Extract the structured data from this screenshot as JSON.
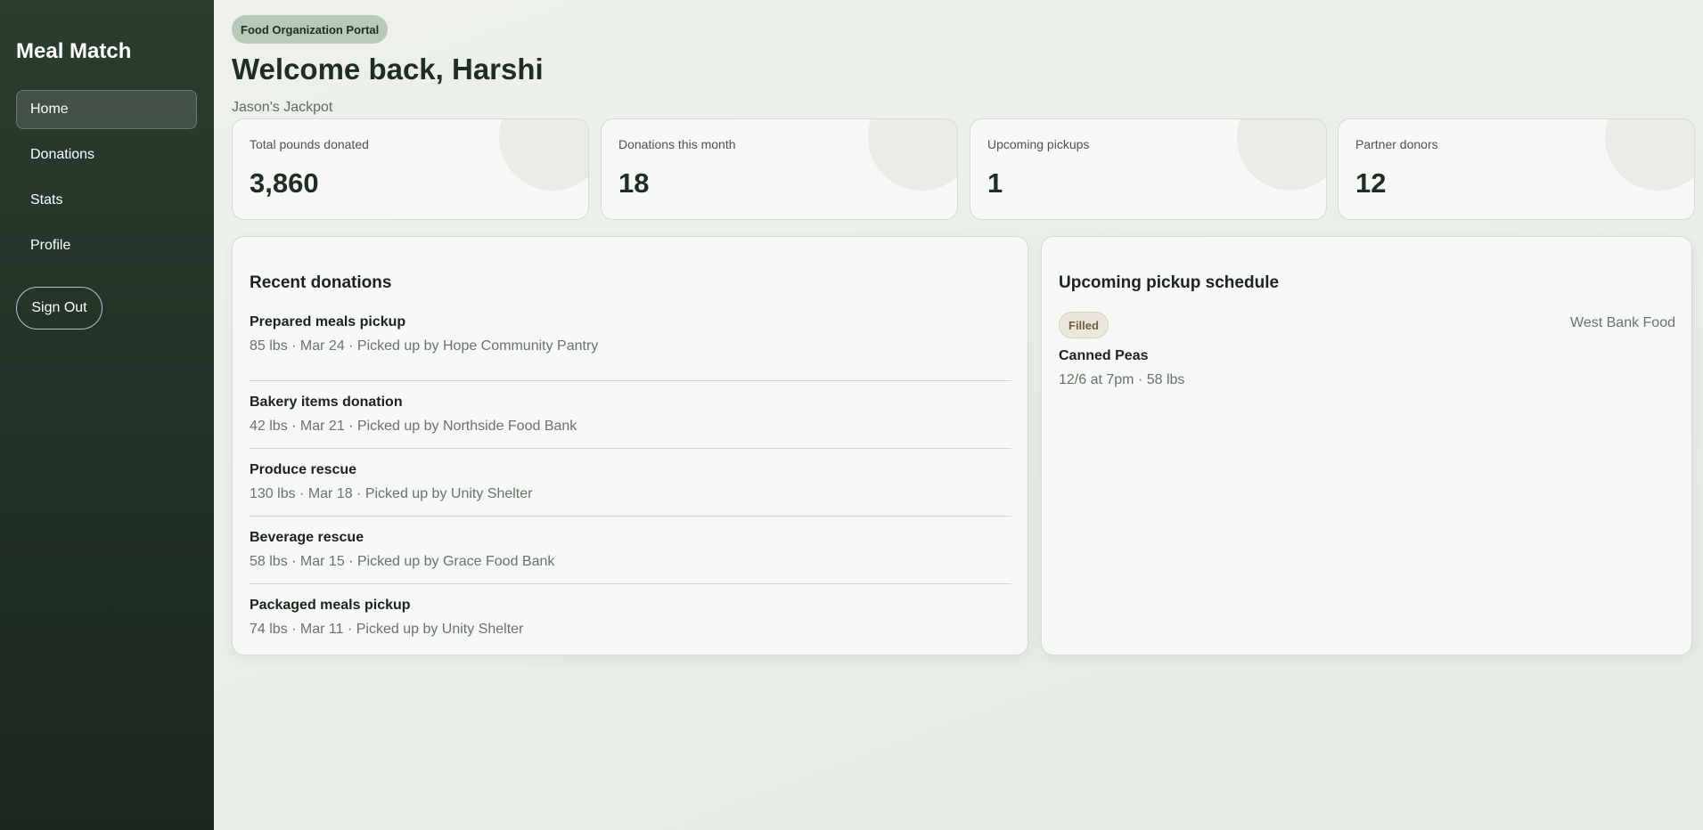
{
  "app": {
    "brand": "Meal Match"
  },
  "sidebar": {
    "items": [
      {
        "label": "Home",
        "active": true
      },
      {
        "label": "Donations",
        "active": false
      },
      {
        "label": "Stats",
        "active": false
      },
      {
        "label": "Profile",
        "active": false
      }
    ],
    "signout_label": "Sign Out"
  },
  "header": {
    "portal_badge": "Food Organization Portal",
    "welcome": "Welcome back, Harshi",
    "org_name": "Jason's Jackpot"
  },
  "stats": [
    {
      "label": "Total pounds donated",
      "value": "3,860"
    },
    {
      "label": "Donations this month",
      "value": "18"
    },
    {
      "label": "Upcoming pickups",
      "value": "1"
    },
    {
      "label": "Partner donors",
      "value": "12"
    }
  ],
  "recent_donations": {
    "title": "Recent donations",
    "items": [
      {
        "name": "Prepared meals pickup",
        "meta": "85 lbs · Mar 24 · Picked up by Hope Community Pantry"
      },
      {
        "name": "Bakery items donation",
        "meta": "42 lbs · Mar 21 · Picked up by Northside Food Bank"
      },
      {
        "name": "Produce rescue",
        "meta": "130 lbs · Mar 18 · Picked up by Unity Shelter"
      },
      {
        "name": "Beverage rescue",
        "meta": "58 lbs · Mar 15 · Picked up by Grace Food Bank"
      },
      {
        "name": "Packaged meals pickup",
        "meta": "74 lbs · Mar 11 · Picked up by Unity Shelter"
      }
    ]
  },
  "pickup_schedule": {
    "title": "Upcoming pickup schedule",
    "items": [
      {
        "status": "Filled",
        "organization": "West Bank Food",
        "name": "Canned Peas",
        "meta": "12/6 at 7pm · 58 lbs"
      }
    ]
  },
  "colors": {
    "sidebar_top": "#2b3d2f",
    "sidebar_bottom": "#1a271d",
    "badge_bg": "#b7c9b8",
    "status_filled_bg": "#ebe7dc"
  }
}
